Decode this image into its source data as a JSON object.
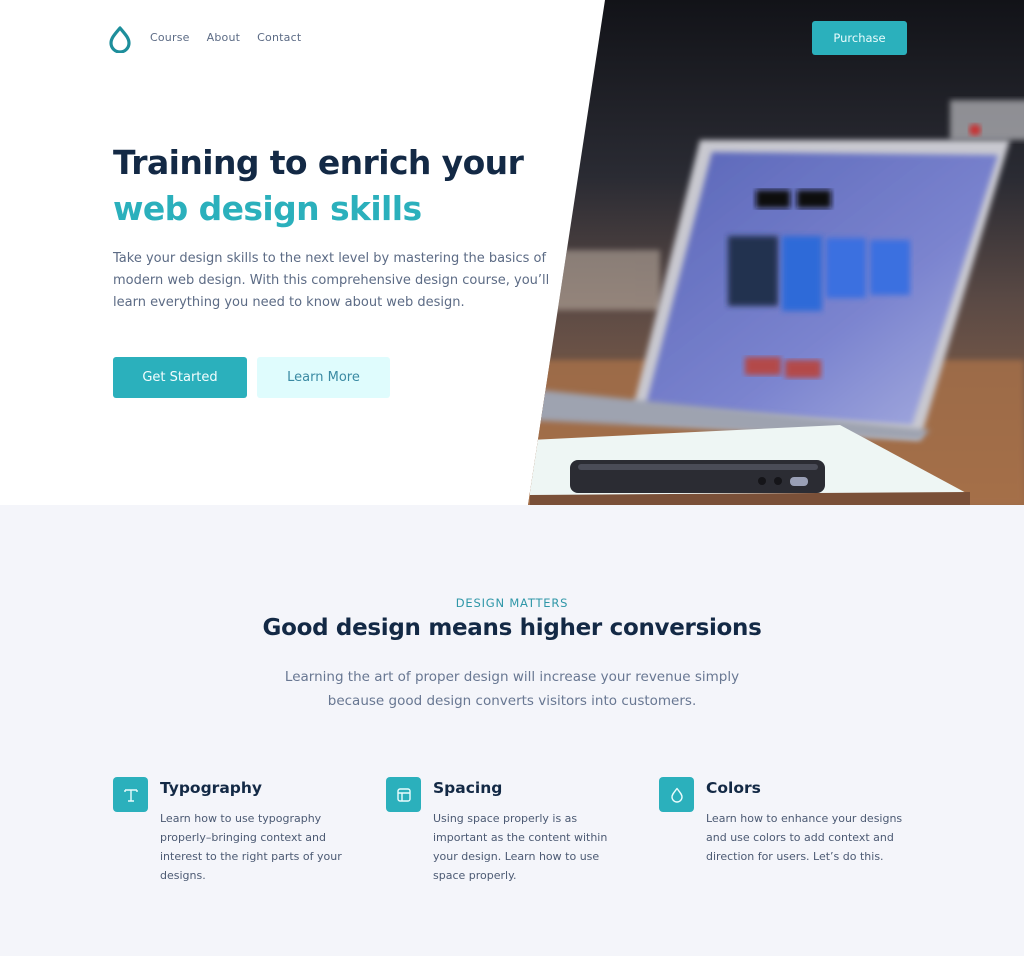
{
  "nav": {
    "logo_icon": "droplet-icon",
    "links": [
      "Course",
      "About",
      "Contact"
    ],
    "purchase_label": "Purchase"
  },
  "hero": {
    "title_line1": "Training to enrich your",
    "title_line2": "web design skills",
    "description": "Take your design skills to the next level by mastering the basics of modern web design. With this comprehensive design course, you’ll learn everything you need to know about web design.",
    "primary_button": "Get Started",
    "secondary_button": "Learn More",
    "image_alt": "Laptop and phone on a desk"
  },
  "features_section": {
    "eyebrow": "DESIGN MATTERS",
    "title": "Good design means higher conversions",
    "description": "Learning the art of proper design will increase your revenue simply because good design converts visitors into customers.",
    "items": [
      {
        "icon": "typography-icon",
        "title": "Typography",
        "text": "Learn how to use typography properly–bringing context and interest to the right parts of your designs."
      },
      {
        "icon": "layout-icon",
        "title": "Spacing",
        "text": "Using space properly is as important as the content within your design. Learn how to use space properly."
      },
      {
        "icon": "droplet-icon",
        "title": "Colors",
        "text": "Learn how to enhance your designs and use colors to add context and direction for users. Let’s do this."
      }
    ]
  },
  "colors": {
    "accent": "#2bb0bc",
    "heading": "#132945",
    "body_text": "#5c6b85",
    "secondary_button_bg": "#dffcfd",
    "section_bg": "#f4f5fa"
  }
}
